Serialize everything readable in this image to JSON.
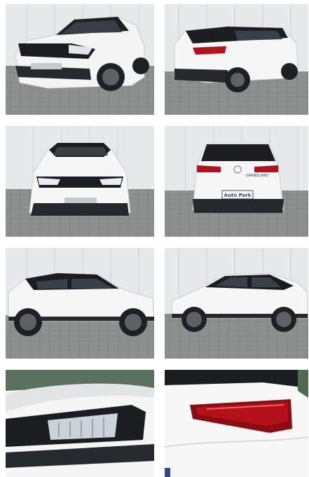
{
  "gallery": {
    "photos": [
      {
        "icon": "car-front-three-quarter-photo"
      },
      {
        "icon": "car-rear-three-quarter-photo"
      },
      {
        "icon": "car-front-photo"
      },
      {
        "icon": "car-rear-photo"
      },
      {
        "icon": "car-left-side-photo"
      },
      {
        "icon": "car-right-side-photo"
      },
      {
        "icon": "headlight-detail-photo"
      },
      {
        "icon": "taillight-detail-photo"
      }
    ],
    "rear_badge_text": "Auto Park",
    "model_script": "GRANDLAND",
    "colors": {
      "wall": "#e6e8ea",
      "ground": "#8d8f8e",
      "body": "#f7f7f7",
      "roof": "#1b1d20",
      "taillight": "#b3121b",
      "badge": "#2d4c8a"
    }
  }
}
